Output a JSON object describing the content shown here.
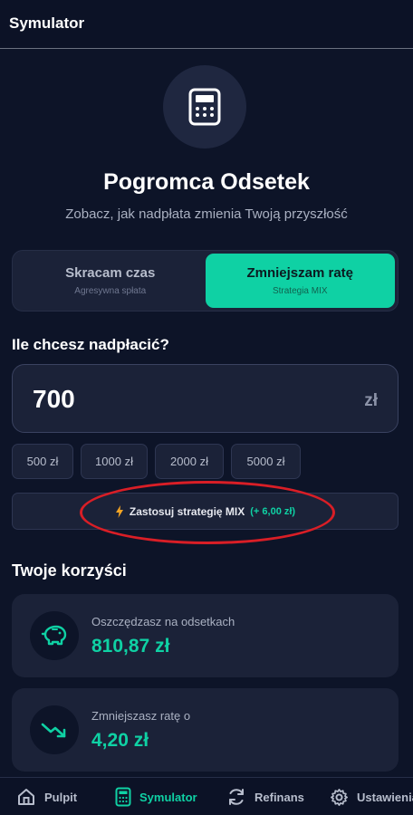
{
  "app": {
    "title": "Symulator"
  },
  "hero": {
    "title": "Pogromca Odsetek",
    "subtitle": "Zobacz, jak nadpłata zmienia Twoją przyszłość",
    "icon": "calculator-icon"
  },
  "mode": {
    "options": [
      {
        "label": "Skracam czas",
        "sub": "Agresywna spłata",
        "active": false
      },
      {
        "label": "Zmniejszam ratę",
        "sub": "Strategia MIX",
        "active": true
      }
    ]
  },
  "overpay": {
    "question": "Ile chcesz nadpłacić?",
    "value": "700",
    "unit": "zł",
    "presets": [
      "500 zł",
      "1000 zł",
      "2000 zł",
      "5000 zł"
    ]
  },
  "mix": {
    "label": "Zastosuj strategię MIX",
    "bonus": "(+ 6,00 zł)",
    "icon": "lightning-icon"
  },
  "benefits": {
    "title": "Twoje korzyści",
    "items": [
      {
        "label": "Oszczędzasz na odsetkach",
        "value": "810,87 zł",
        "icon": "piggy-bank-icon"
      },
      {
        "label": "Zmniejszasz ratę o",
        "value": "4,20 zł",
        "icon": "trend-down-icon"
      }
    ]
  },
  "nav": {
    "items": [
      {
        "label": "Pulpit",
        "icon": "home-icon"
      },
      {
        "label": "Symulator",
        "icon": "calculator-icon",
        "active": true
      },
      {
        "label": "Refinans",
        "icon": "refresh-icon"
      },
      {
        "label": "Ustawienia",
        "icon": "gear-icon"
      }
    ]
  },
  "colors": {
    "background": "#0d1428",
    "card": "#1b2238",
    "accent": "#0fd1a4",
    "annotation": "#d91e26"
  }
}
